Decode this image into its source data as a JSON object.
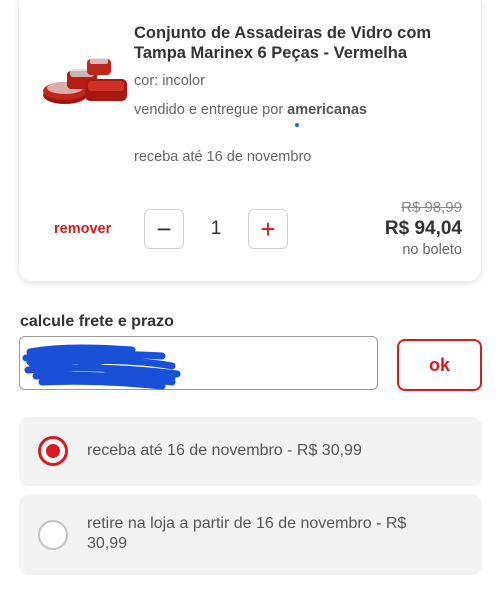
{
  "product": {
    "title": "Conjunto de Assadeiras de Vidro com Tampa Marinex 6 Peças - Vermelha",
    "color": "cor: incolor",
    "seller_prefix": "vendido e entregue por ",
    "seller_name": "americanas",
    "delivery": "receba até 16 de novembro",
    "thumbnail_icon": "glass-baking-dish-set-image"
  },
  "cart_item": {
    "remove_label": "remover",
    "quantity": "1",
    "minus_label": "−",
    "plus_label": "+",
    "old_price": "R$ 98,99",
    "price": "R$ 94,04",
    "payment_note": "no boleto"
  },
  "freight": {
    "label": "calcule frete e prazo",
    "zip_value": "",
    "ok_label": "ok",
    "options": [
      {
        "label": "receba até 16 de novembro - R$ 30,99",
        "selected": true
      },
      {
        "label": "retire na loja a partir de 16 de novembro - R$ 30,99",
        "selected": false
      }
    ]
  },
  "colors": {
    "accent": "#d81b22",
    "redaction": "#1a4fd8"
  }
}
